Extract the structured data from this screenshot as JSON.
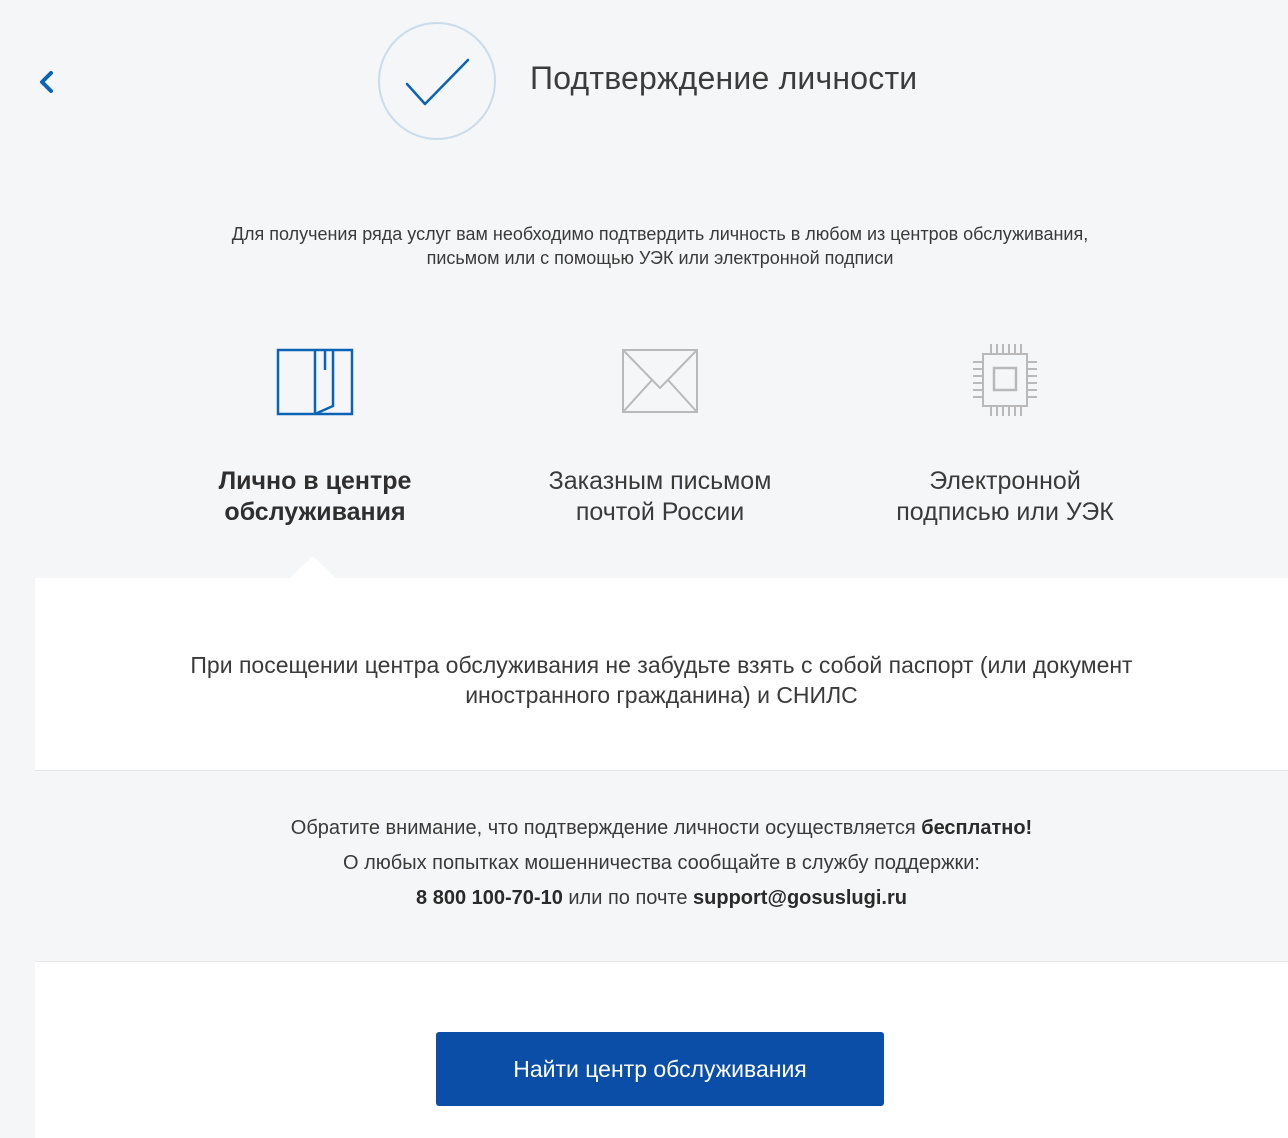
{
  "header": {
    "back_icon": "chevron-left-icon",
    "status_icon": "checkmark-icon",
    "title": "Подтверждение личности"
  },
  "intro": {
    "line1": "Для получения ряда услуг вам необходимо подтвердить личность в любом из центров обслуживания,",
    "line2": "письмом или с помощью УЭК или электронной подписи"
  },
  "methods": [
    {
      "icon": "book-icon",
      "line1": "Лично в центре",
      "line2": "обслуживания",
      "active": true
    },
    {
      "icon": "envelope-icon",
      "line1": "Заказным письмом",
      "line2": "почтой России",
      "active": false
    },
    {
      "icon": "chip-icon",
      "line1": "Электронной",
      "line2": "подписью или УЭК",
      "active": false
    }
  ],
  "panel": {
    "reminder_line1": "При посещении центра обслуживания не забудьте взять с собой паспорт (или документ",
    "reminder_line2": "иностранного гражданина) и СНИЛС",
    "notice": {
      "line1_text": "Обратите внимание, что подтверждение личности осуществляется ",
      "line1_bold": "бесплатно!",
      "line2": "О любых попытках мошенничества сообщайте в службу поддержки:",
      "phone": "8 800 100-70-10",
      "line3_mid": " или по почте ",
      "email": "support@gosuslugi.ru"
    },
    "button_label": "Найти центр обслуживания"
  },
  "colors": {
    "accent": "#0b4ea8",
    "icon_active": "#0b63b6",
    "icon_inactive": "#b9b9b9",
    "background": "#f5f6f7",
    "panel": "#ffffff"
  }
}
